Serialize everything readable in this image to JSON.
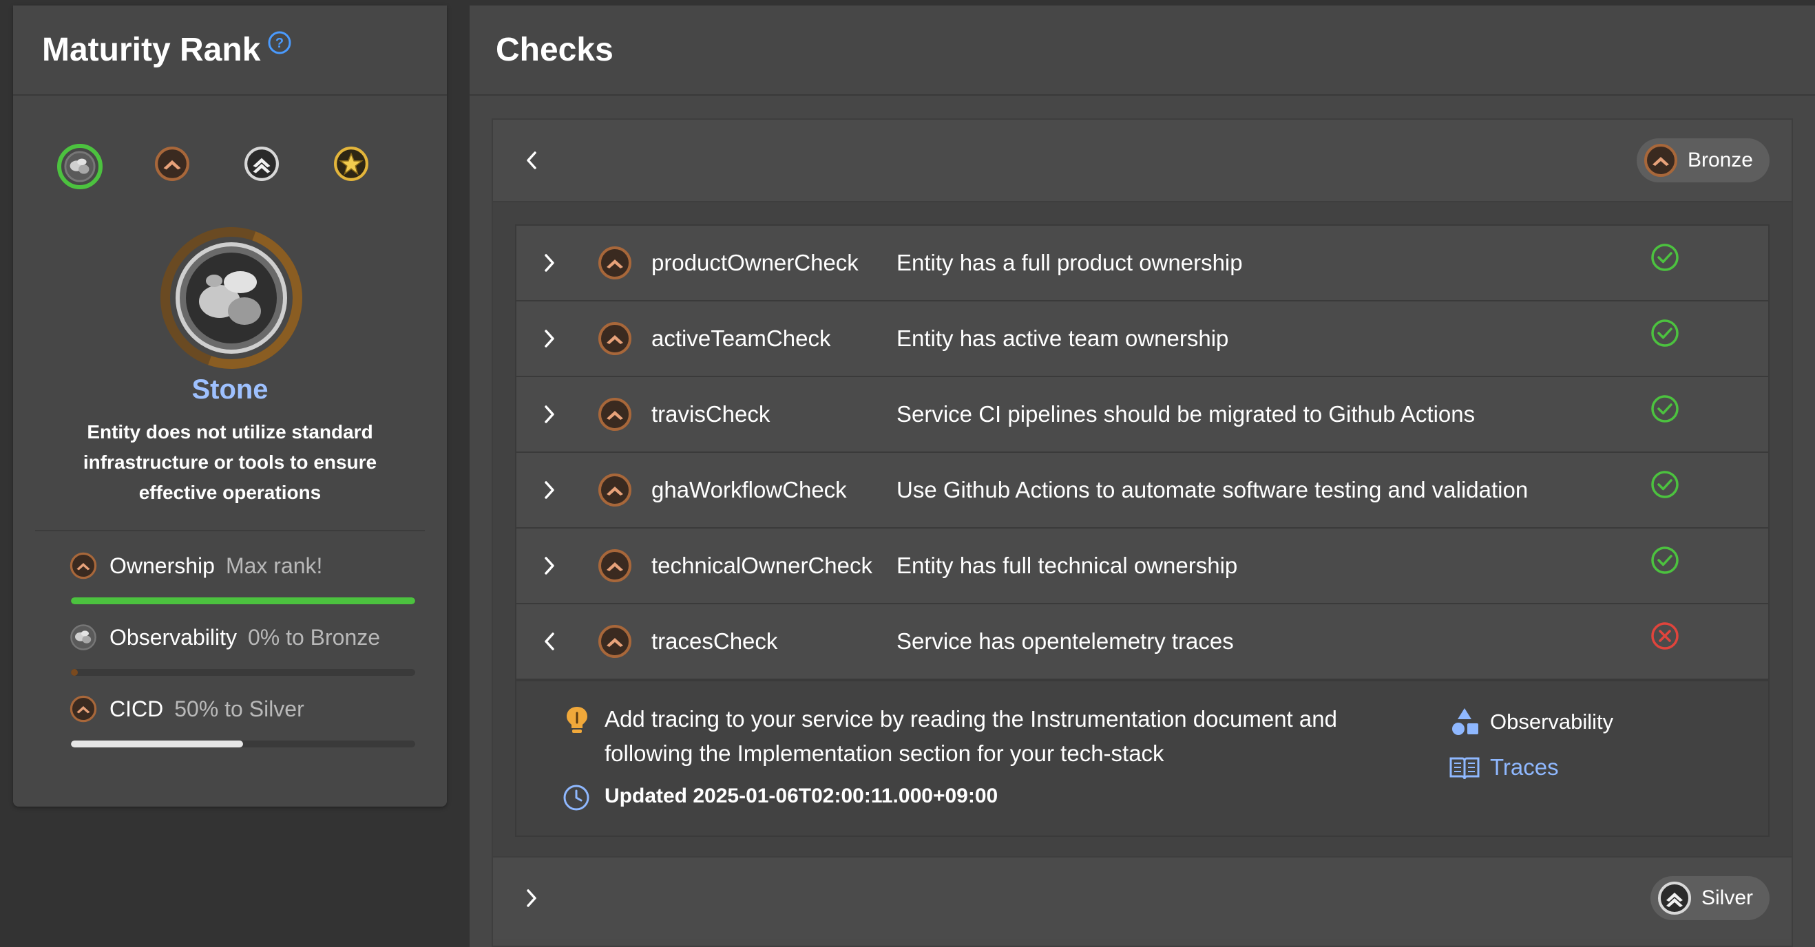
{
  "maturity": {
    "title": "Maturity Rank",
    "help_icon": "question-circle-icon",
    "ranks": [
      "Stone",
      "Bronze",
      "Silver",
      "Gold"
    ],
    "current_rank": "Stone",
    "description": "Entity does not utilize standard infrastructure or tools to ensure effective operations",
    "categories": [
      {
        "name": "Ownership",
        "status": "Max rank!",
        "progress": 1.0,
        "bar_color": "#4cc23f",
        "rank": "Bronze"
      },
      {
        "name": "Observability",
        "status": "0% to Bronze",
        "progress": 0.02,
        "bar_color": "#7a4a1f",
        "rank": "Stone"
      },
      {
        "name": "CICD",
        "status": "50% to Silver",
        "progress": 0.5,
        "bar_color": "#e6e6e6",
        "rank": "Bronze"
      }
    ]
  },
  "checks": {
    "title": "Checks",
    "groups": [
      {
        "rank": "Bronze",
        "expanded": true,
        "items": [
          {
            "name": "productOwnerCheck",
            "description": "Entity has a full product ownership",
            "passed": true
          },
          {
            "name": "activeTeamCheck",
            "description": "Entity has active team ownership",
            "passed": true
          },
          {
            "name": "travisCheck",
            "description": "Service CI pipelines should be migrated to Github Actions",
            "passed": true
          },
          {
            "name": "ghaWorkflowCheck",
            "description": "Use Github Actions to automate software testing and validation",
            "passed": true
          },
          {
            "name": "technicalOwnerCheck",
            "description": "Entity has full technical ownership",
            "passed": true
          },
          {
            "name": "tracesCheck",
            "description": "Service has opentelemetry traces",
            "passed": false,
            "expanded": true
          }
        ],
        "detail": {
          "hint": "Add tracing to your service by reading the Instrumentation document and following the Implementation section for your tech-stack",
          "updated": "Updated 2025-01-06T02:00:11.000+09:00",
          "category": "Observability",
          "link": "Traces"
        }
      },
      {
        "rank": "Silver",
        "expanded": false
      }
    ]
  },
  "colors": {
    "pass": "#4cc23f",
    "fail": "#e0443c",
    "link": "#8fb8ff",
    "accent": "#9ec1ff"
  }
}
